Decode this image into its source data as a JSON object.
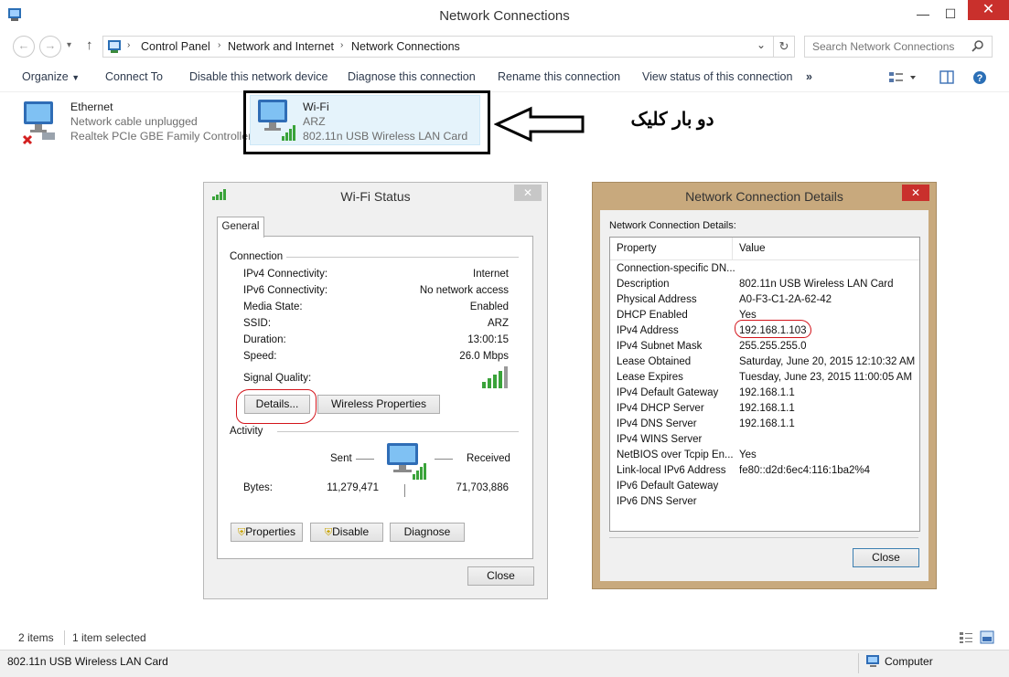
{
  "window": {
    "title": "Network Connections",
    "minimize": "—",
    "maximize": "☐",
    "close": "✕"
  },
  "address": {
    "crumbs": [
      "Control Panel",
      "Network and Internet",
      "Network Connections"
    ],
    "search_placeholder": "Search Network Connections"
  },
  "toolbar": {
    "organize": "Organize",
    "connect_to": "Connect To",
    "disable": "Disable this network device",
    "diagnose": "Diagnose this connection",
    "rename": "Rename this connection",
    "view_status": "View status of this connection",
    "more": "»"
  },
  "connections": [
    {
      "name": "Ethernet",
      "status": "Network cable unplugged",
      "device": "Realtek PCIe GBE Family Controller"
    },
    {
      "name": "Wi-Fi",
      "status": "ARZ",
      "device": "802.11n USB Wireless LAN Card"
    }
  ],
  "annotation": {
    "text": "دو بار کلیک"
  },
  "wifi_status": {
    "title": "Wi-Fi Status",
    "tab": "General",
    "connection_heading": "Connection",
    "rows": [
      {
        "label": "IPv4 Connectivity:",
        "value": "Internet"
      },
      {
        "label": "IPv6 Connectivity:",
        "value": "No network access"
      },
      {
        "label": "Media State:",
        "value": "Enabled"
      },
      {
        "label": "SSID:",
        "value": "ARZ"
      },
      {
        "label": "Duration:",
        "value": "13:00:15"
      },
      {
        "label": "Speed:",
        "value": "26.0 Mbps"
      }
    ],
    "signal_label": "Signal Quality:",
    "details_button": "Details...",
    "wireless_props_button": "Wireless Properties",
    "activity_heading": "Activity",
    "sent_label": "Sent",
    "received_label": "Received",
    "bytes_label": "Bytes:",
    "bytes_sent": "11,279,471",
    "bytes_received": "71,703,886",
    "properties_button": "Properties",
    "disable_button": "Disable",
    "diagnose_button": "Diagnose",
    "close_button": "Close"
  },
  "details": {
    "title": "Network Connection Details",
    "subtitle": "Network Connection Details:",
    "col_property": "Property",
    "col_value": "Value",
    "rows": [
      {
        "property": "Connection-specific DN...",
        "value": ""
      },
      {
        "property": "Description",
        "value": "802.11n USB Wireless LAN Card"
      },
      {
        "property": "Physical Address",
        "value": "A0-F3-C1-2A-62-42"
      },
      {
        "property": "DHCP Enabled",
        "value": "Yes"
      },
      {
        "property": "IPv4 Address",
        "value": "192.168.1.103"
      },
      {
        "property": "IPv4 Subnet Mask",
        "value": "255.255.255.0"
      },
      {
        "property": "Lease Obtained",
        "value": "Saturday, June 20, 2015 12:10:32 AM"
      },
      {
        "property": "Lease Expires",
        "value": "Tuesday, June 23, 2015 11:00:05 AM"
      },
      {
        "property": "IPv4 Default Gateway",
        "value": "192.168.1.1"
      },
      {
        "property": "IPv4 DHCP Server",
        "value": "192.168.1.1"
      },
      {
        "property": "IPv4 DNS Server",
        "value": "192.168.1.1"
      },
      {
        "property": "IPv4 WINS Server",
        "value": ""
      },
      {
        "property": "NetBIOS over Tcpip En...",
        "value": "Yes"
      },
      {
        "property": "Link-local IPv6 Address",
        "value": "fe80::d2d:6ec4:116:1ba2%4"
      },
      {
        "property": "IPv6 Default Gateway",
        "value": ""
      },
      {
        "property": "IPv6 DNS Server",
        "value": ""
      }
    ],
    "close_button": "Close",
    "close_x": "✕"
  },
  "status_bar": {
    "items": "2 items",
    "selected": "1 item selected",
    "device": "802.11n USB Wireless LAN Card",
    "computer": "Computer"
  },
  "colors": {
    "accent": "#3a6fb5",
    "annotation_red": "#d3141b",
    "details_frame": "#c8a97d",
    "close_red": "#c9302c"
  }
}
